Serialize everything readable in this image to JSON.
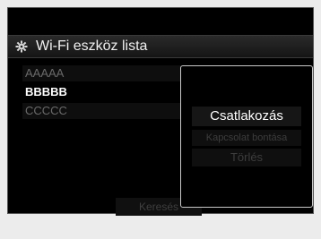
{
  "title_bar": {
    "icon": "wifi-settings-icon",
    "title": "Wi-Fi eszköz lista"
  },
  "device_list": {
    "items": [
      {
        "label": "AAAAA",
        "state": "dimmed"
      },
      {
        "label": "BBBBB",
        "state": "highlighted"
      },
      {
        "label": "CCCCC",
        "state": "dimmed"
      }
    ]
  },
  "footer": {
    "search_label": "Keresés"
  },
  "popup": {
    "connect_label": "Csatlakozás",
    "disconnect_label": "Kapcsolat bontása",
    "delete_label": "Törlés"
  }
}
